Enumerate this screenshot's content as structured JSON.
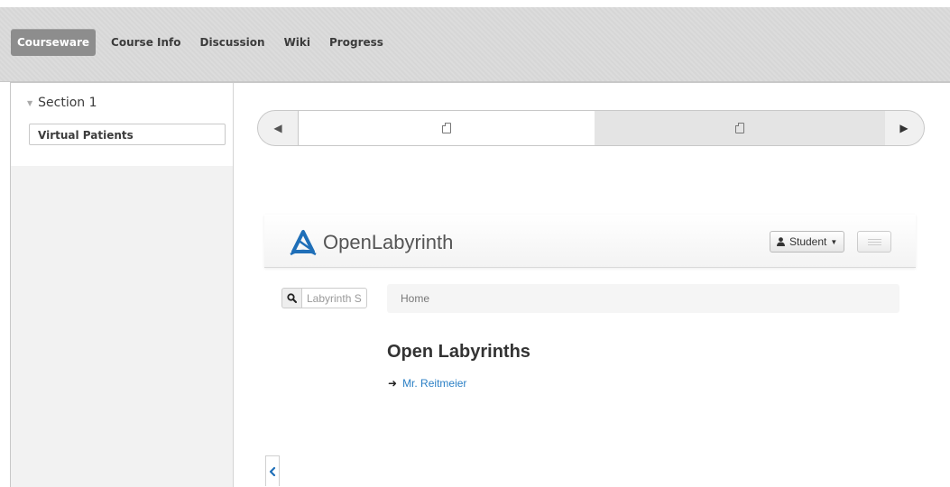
{
  "course_nav": {
    "tabs": [
      {
        "label": "Courseware",
        "active": true
      },
      {
        "label": "Course Info",
        "active": false
      },
      {
        "label": "Discussion",
        "active": false
      },
      {
        "label": "Wiki",
        "active": false
      },
      {
        "label": "Progress",
        "active": false
      }
    ]
  },
  "sidebar": {
    "section_label": "Section 1",
    "items": [
      {
        "label": "Virtual Patients",
        "active": true
      }
    ]
  },
  "sequence_nav": {
    "prev_icon": "triangle-left-icon",
    "next_icon": "triangle-right-icon",
    "items": [
      {
        "icon": "document-icon",
        "active": true
      },
      {
        "icon": "document-icon",
        "active": false
      }
    ]
  },
  "openlabyrinth": {
    "brand": "OpenLabyrinth",
    "user_button": "Student",
    "search": {
      "placeholder": "Labyrinth Search"
    },
    "breadcrumb": "Home",
    "heading": "Open Labyrinths",
    "links": [
      {
        "label": "Mr. Reitmeier"
      }
    ]
  },
  "colors": {
    "active_tab_bg": "#8d8d8d",
    "link": "#2a7fc5",
    "logo_blue": "#1f6fb8"
  }
}
